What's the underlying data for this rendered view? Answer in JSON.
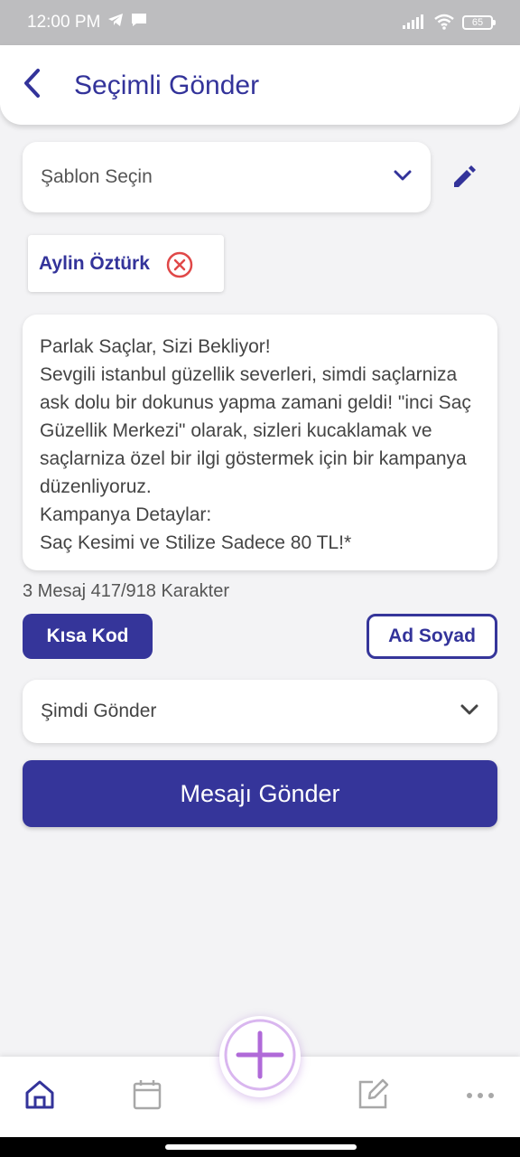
{
  "status_bar": {
    "time": "12:00 PM",
    "battery": "65"
  },
  "header": {
    "title": "Seçimli Gönder"
  },
  "template_select": {
    "placeholder": "Şablon Seçin"
  },
  "recipients": [
    {
      "name": "Aylin Öztürk"
    }
  ],
  "message": {
    "text": "Parlak Saçlar, Sizi Bekliyor!\nSevgili istanbul güzellik severleri, simdi saçlarniza ask dolu bir dokunus yapma zamani geldi! \"inci Saç Güzellik Merkezi\" olarak, sizleri kucaklamak ve saçlarniza özel bir ilgi göstermek için bir kampanya düzenliyoruz.\nKampanya Detaylar:\nSaç Kesimi ve Stilize Sadece 80 TL!*",
    "counter": "3 Mesaj 417/918 Karakter"
  },
  "buttons": {
    "short_code": "Kısa Kod",
    "full_name": "Ad Soyad",
    "send": "Mesajı Gönder"
  },
  "schedule_select": {
    "value": "Şimdi Gönder"
  },
  "colors": {
    "primary": "#35359a",
    "remove": "#e04848",
    "fab_plus": "#b06ad8",
    "nav_active": "#33339a",
    "nav_inactive": "#a8a8a8"
  },
  "bottom_nav": {
    "items": [
      "home-icon",
      "calendar-icon",
      "add-icon",
      "edit-icon",
      "more-icon"
    ],
    "active": "home-icon"
  }
}
